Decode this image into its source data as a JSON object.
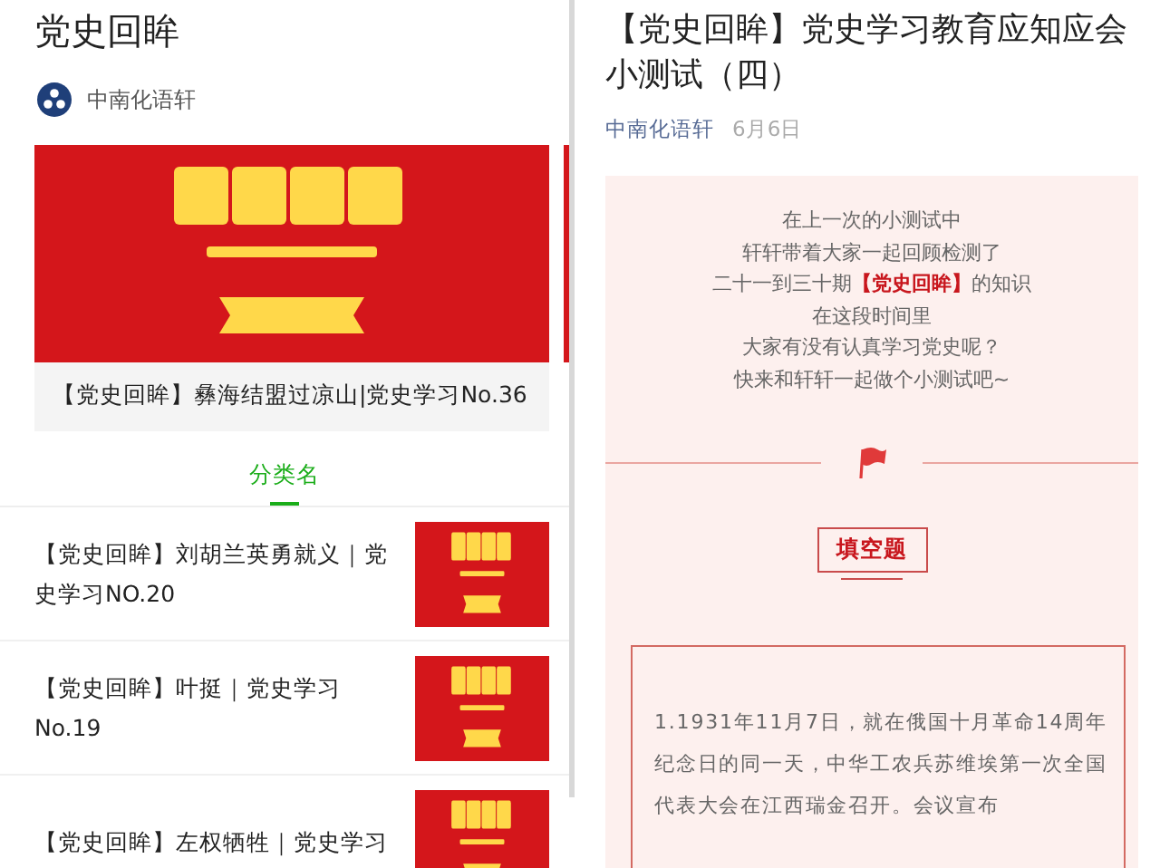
{
  "left": {
    "title": "党史回眸",
    "account": {
      "name": "中南化语轩"
    },
    "featured": [
      {
        "caption": "【党史回眸】彝海结盟过凉山|党史学习No.36"
      }
    ],
    "tabs": [
      {
        "label": "分类名",
        "selected": true
      }
    ],
    "articles": [
      {
        "title": "【党史回眸】刘胡兰英勇就义｜党史学习NO.20"
      },
      {
        "title": "【党史回眸】叶挺｜党史学习No.19"
      },
      {
        "title": "【党史回眸】左权牺牲｜党史学习"
      }
    ]
  },
  "right": {
    "title": "【党史回眸】党史学习教育应知应会小测试（四）",
    "author": "中南化语轩",
    "date": "6月6日",
    "intro": [
      "在上一次的小测试中",
      "轩轩带着大家一起回顾检测了",
      "二十一到三十期**【党史回眸】**的知识",
      "在这段时间里",
      "大家有没有认真学习党史呢？",
      "快来和轩轩一起做个小测试吧~"
    ],
    "section_label": "填空题",
    "question": "1.1931年11月7日，就在俄国十月革命14周年纪念日的同一天，中华工农兵苏维埃第一次全国代表大会在江西瑞金召开。会议宣布"
  }
}
